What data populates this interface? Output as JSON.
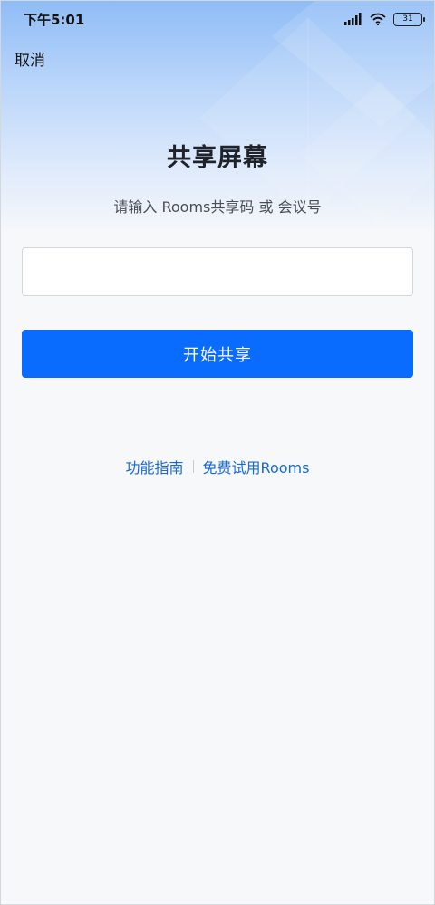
{
  "status_bar": {
    "time": "下午5:01",
    "battery_level": "31",
    "signal_icon": "signal-bars-icon",
    "wifi_icon": "wifi-icon"
  },
  "header": {
    "cancel_label": "取消"
  },
  "main": {
    "title": "共享屏幕",
    "subtitle": "请输入 Rooms共享码 或 会议号",
    "code_input_value": "",
    "code_input_placeholder": "",
    "start_button_label": "开始共享"
  },
  "footer_links": {
    "guide_label": "功能指南",
    "trial_label": "免费试用Rooms"
  },
  "colors": {
    "accent": "#0a6cff",
    "link": "#1769d6"
  }
}
